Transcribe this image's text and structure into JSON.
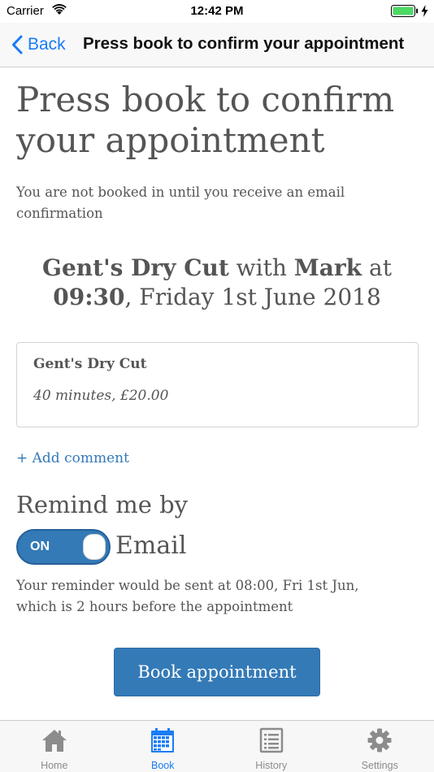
{
  "status_bar": {
    "carrier": "Carrier",
    "time": "12:42 PM"
  },
  "nav": {
    "back_label": "Back",
    "title": "Press book to confirm your appointment"
  },
  "content": {
    "heading": "Press book to confirm your appointment",
    "notice": "You are not booked in until you receive an email confirmation",
    "summary": {
      "service": "Gent's Dry Cut",
      "with_text": " with ",
      "staff": "Mark",
      "at_text": " at ",
      "time": "09:30",
      "date_text": ", Friday 1st June 2018"
    },
    "service_card": {
      "name": "Gent's Dry Cut",
      "details": "40 minutes, £20.00"
    },
    "add_comment": "+ Add comment",
    "remind": {
      "heading": "Remind me by",
      "toggle_state": "ON",
      "toggle_on": true,
      "method": "Email",
      "note": "Your reminder would be sent at 08:00, Fri 1st Jun, which is 2 hours before the appointment"
    },
    "book_button": "Book appointment"
  },
  "tabs": [
    {
      "label": "Home",
      "icon": "home-icon",
      "active": false
    },
    {
      "label": "Book",
      "icon": "calendar-icon",
      "active": true
    },
    {
      "label": "History",
      "icon": "list-icon",
      "active": false
    },
    {
      "label": "Settings",
      "icon": "gear-icon",
      "active": false
    }
  ],
  "colors": {
    "accent": "#337ab7",
    "ios_blue": "#1a7cf5",
    "battery": "#4cd964",
    "text": "#555555"
  }
}
